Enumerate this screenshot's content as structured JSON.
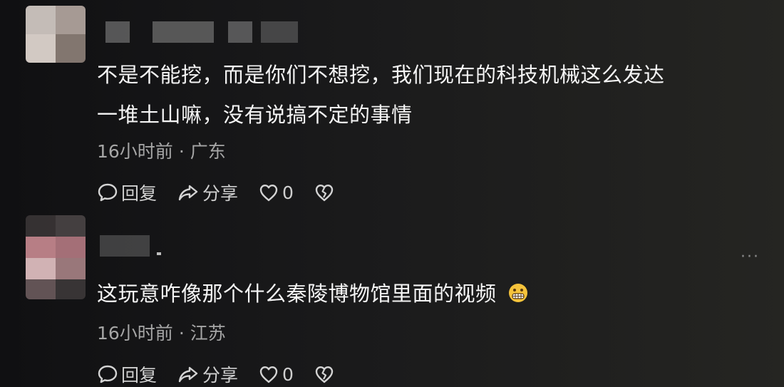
{
  "comments": [
    {
      "text_line1": "不是不能挖，而是你们不想挖，我们现在的科技机械这么发达",
      "text_line2": "一堆土山嘛，没有说搞不定的事情",
      "time": "16小时前",
      "location": "广东",
      "reply_label": "回复",
      "share_label": "分享",
      "like_count": "0"
    },
    {
      "text_line1": "这玩意咋像那个什么秦陵博物馆里面的视频",
      "time": "16小时前",
      "location": "江苏",
      "reply_label": "回复",
      "share_label": "分享",
      "like_count": "0",
      "more_label": "···",
      "emoji_icon": "grimacing-face-emoji"
    }
  ],
  "separator": "·",
  "icons": [
    "comment-bubble-icon",
    "share-arrow-icon",
    "heart-icon",
    "broken-heart-icon",
    "more-options-icon"
  ]
}
